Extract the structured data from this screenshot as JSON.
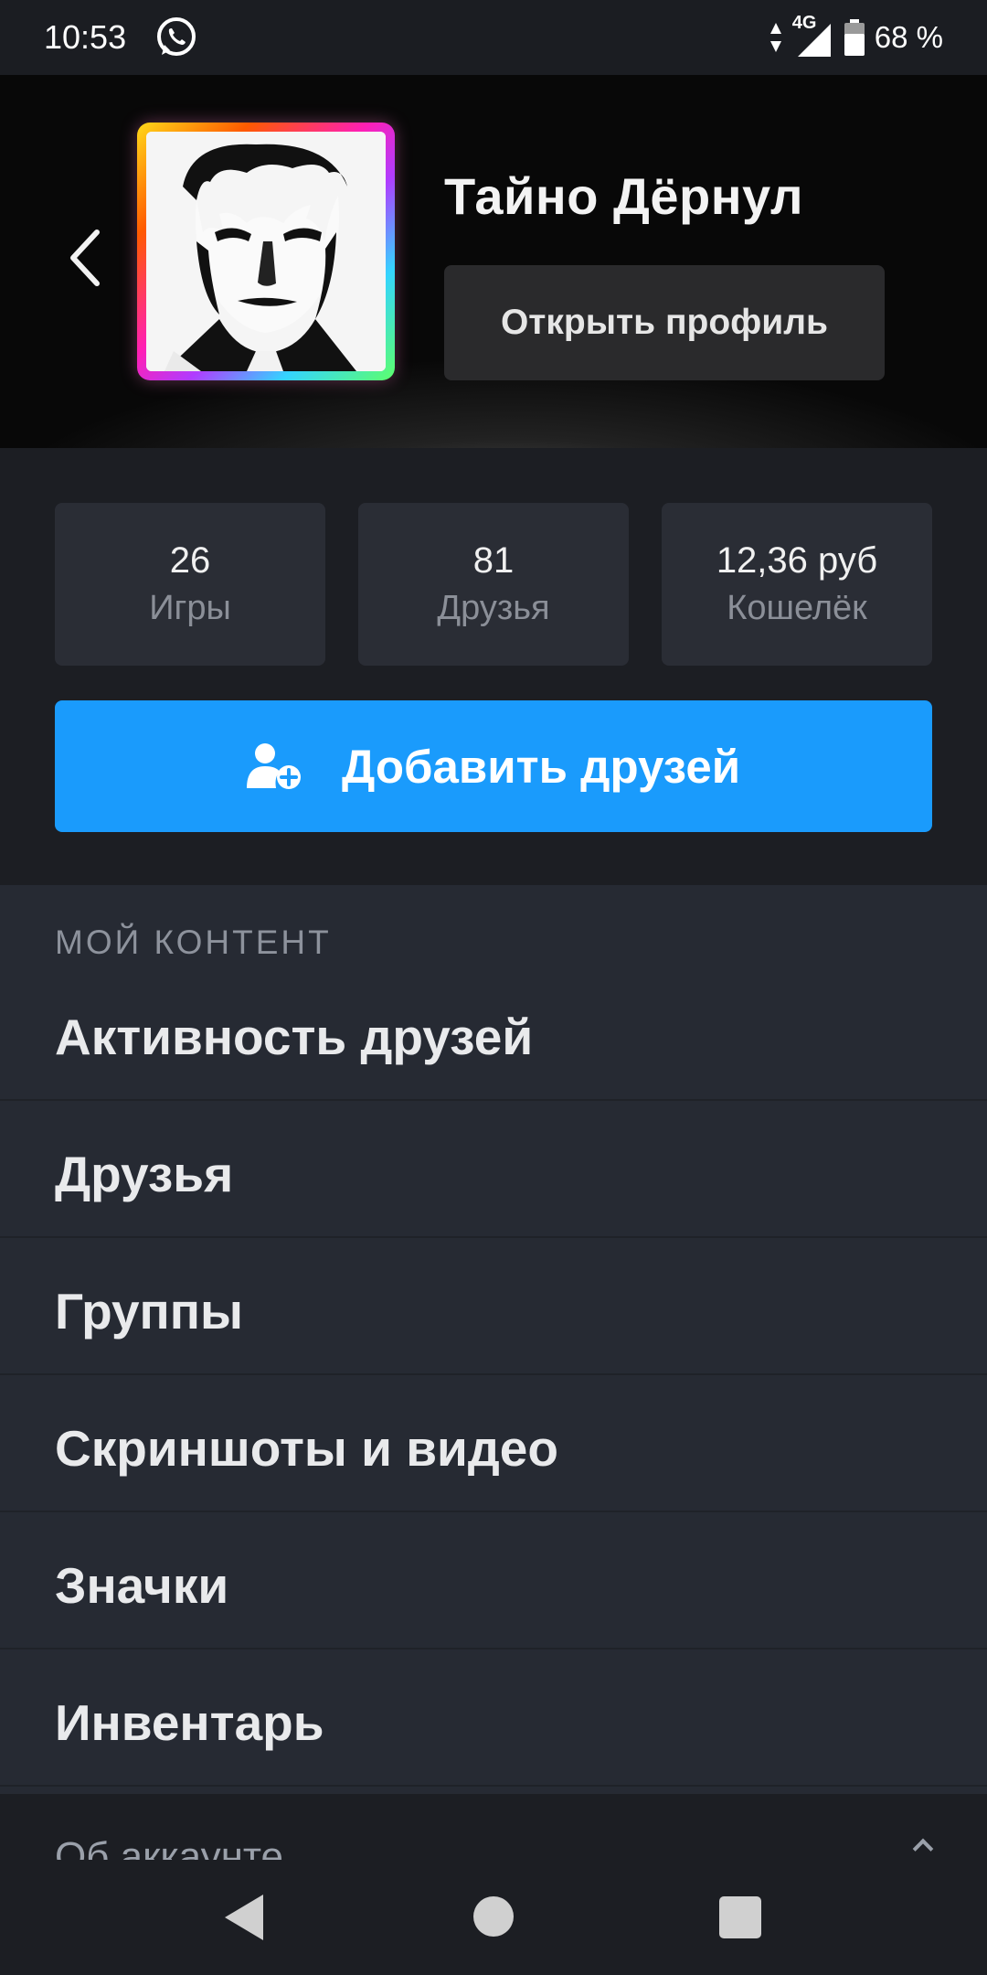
{
  "status_bar": {
    "time": "10:53",
    "network": "4G",
    "battery": "68 %",
    "icons": [
      "whatsapp-icon",
      "data-arrows-icon",
      "signal-icon",
      "battery-icon"
    ]
  },
  "header": {
    "back_icon": "chevron-left-icon",
    "profile_name": "Тайно Дёрнул",
    "open_profile_label": "Открыть профиль"
  },
  "stats": [
    {
      "value": "26",
      "label": "Игры"
    },
    {
      "value": "81",
      "label": "Друзья"
    },
    {
      "value": "12,36 руб",
      "label": "Кошелёк"
    }
  ],
  "add_friends": {
    "label": "Добавить друзей",
    "icon": "add-user-icon"
  },
  "content": {
    "section_title": "МОЙ КОНТЕНТ",
    "items": [
      {
        "label": "Активность друзей"
      },
      {
        "label": "Друзья"
      },
      {
        "label": "Группы"
      },
      {
        "label": "Скриншоты и видео"
      },
      {
        "label": "Значки"
      },
      {
        "label": "Инвентарь"
      }
    ],
    "cut_item": "Об аккаунте"
  },
  "colors": {
    "accent": "#1a9bfc",
    "background": "#262a33",
    "header_bg": "#080808"
  },
  "nav": {
    "icons": [
      "nav-back-icon",
      "nav-home-icon",
      "nav-recents-icon"
    ]
  }
}
